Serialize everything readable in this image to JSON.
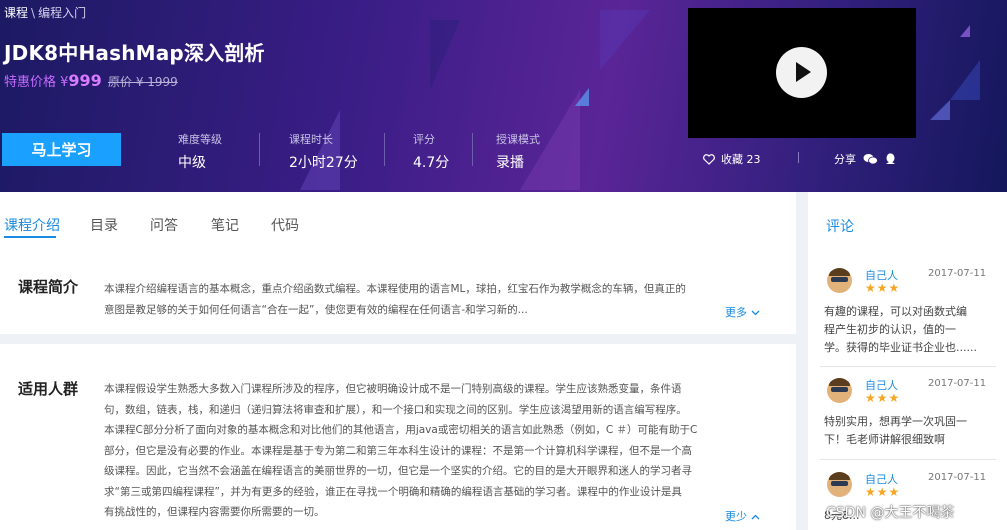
{
  "breadcrumb": {
    "root": "课程",
    "separator": "\\",
    "current": "编程入门"
  },
  "course": {
    "title": "JDK8中HashMap深入剖析",
    "price_label": "特惠价格 ¥",
    "price_value": "999",
    "original_price": "原价 ¥ 1999"
  },
  "actions": {
    "learn_label": "马上学习"
  },
  "stats": [
    {
      "label": "难度等级",
      "value": "中级"
    },
    {
      "label": "课程时长",
      "value": "2小时27分"
    },
    {
      "label": "评分",
      "value": "4.7分"
    },
    {
      "label": "授课模式",
      "value": "录播"
    }
  ],
  "favorite": {
    "label": "收藏 23",
    "icon": "heart-icon"
  },
  "share": {
    "label": "分享",
    "icons": [
      "wechat-icon",
      "qq-icon"
    ]
  },
  "tabs": [
    {
      "label": "课程介绍",
      "active": true
    },
    {
      "label": "目录"
    },
    {
      "label": "问答"
    },
    {
      "label": "笔记"
    },
    {
      "label": "代码"
    }
  ],
  "comments_title": "评论",
  "intro": {
    "title": "课程简介",
    "lines": [
      "本课程介绍编程语言的基本概念，重点介绍函数式编程。本课程使用的语言ML，球拍，红宝石作为教学概念的车辆，但真正的",
      "意图是教足够的关于如何任何语言“合在一起”，使您更有效的编程在任何语言-和学习新的..."
    ],
    "more_label": "更多"
  },
  "audience": {
    "title": "适用人群",
    "lines": [
      "本课程假设学生熟悉大多数入门课程所涉及的程序，但它被明确设计成不是一门特别高级的课程。学生应该熟悉变量，条件语",
      "句，数组，链表，栈，和递归（递归算法将审查和扩展），和一个接口和实现之间的区别。学生应该渴望用新的语言编写程序。",
      "本课程C部分分析了面向对象的基本概念和对比他们的其他语言，用java或密切相关的语言如此熟悉（例如，C ＃）可能有助于C",
      "部分，但它是没有必要的作业。本课程是基于专为第二和第三年本科生设计的课程：不是第一个计算机科学课程，但不是一个高",
      "级课程。因此，它当然不会涵盖在编程语言的美丽世界的一切，但它是一个坚实的介绍。它的目的是大开眼界和迷人的学习者寻",
      "求“第三或第四编程课程”，并为有更多的经验，谁正在寻找一个明确和精确的编程语言基础的学习者。课程中的作业设计是具",
      "有挑战性的，但课程内容需要你所需要的一切。"
    ],
    "more_label": "更少"
  },
  "comments": [
    {
      "name": "自己人",
      "date": "2017-07-11",
      "stars": "★★★",
      "lines": [
        "有趣的课程，可以对函数式编",
        "程产生初步的认识，值的一",
        "学。获得的毕业证书企业也......"
      ]
    },
    {
      "name": "自己人",
      "date": "2017-07-11",
      "stars": "★★★",
      "lines": [
        "特别实用，想再学一次巩固一",
        "下！毛老师讲解很细致啊"
      ]
    },
    {
      "name": "自己人",
      "date": "2017-07-11",
      "stars": "★★★",
      "lines": [
        "8元8..."
      ]
    }
  ],
  "watermark": "CSDN @大王不喝茶"
}
